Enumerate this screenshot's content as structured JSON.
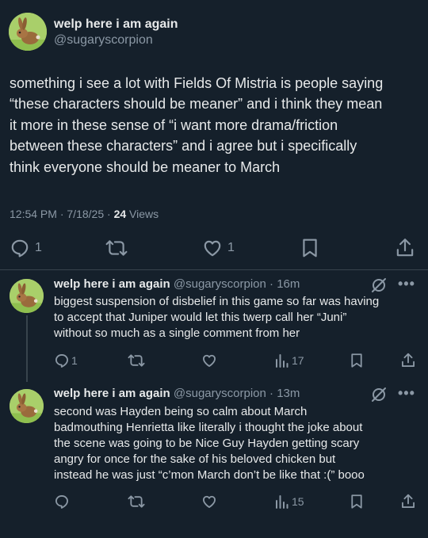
{
  "main_tweet": {
    "author_name": "welp here i am again",
    "author_handle": "@sugaryscorpion",
    "text_lines": [
      "something i see a lot with Fields Of Mistria is people saying",
      "“these characters should be meaner” and i think they mean",
      "it more in these sense of “i want more drama/friction",
      "between these characters” and i agree but i specifically",
      "think everyone should be meaner to March"
    ],
    "time": "12:54 PM",
    "date": "7/18/25",
    "separator": "·",
    "views_count": "24",
    "views_label": "Views",
    "replies": "1",
    "likes": "1",
    "icons": [
      "reply-icon",
      "retweet-icon",
      "like-icon",
      "bookmark-icon",
      "share-icon"
    ]
  },
  "replies": [
    {
      "author_name": "welp here i am again",
      "author_handle": "@sugaryscorpion",
      "separator": "·",
      "age": "16m",
      "text_lines": [
        "biggest suspension of disbelief in this game so far was having",
        "to accept that Juniper would let this twerp call her “Juni”",
        "without so much as a single comment from her"
      ],
      "reply_count": "1",
      "views": "17"
    },
    {
      "author_name": "welp here i am again",
      "author_handle": "@sugaryscorpion",
      "separator": "·",
      "age": "13m",
      "text_lines": [
        "second was Hayden being so calm about March",
        "badmouthing Henrietta like literally i thought the joke about",
        "the scene was going to be Nice Guy Hayden getting scary",
        "angry for once for the sake of his beloved chicken but",
        "instead he was just “c’mon March don’t be like that :(” booo"
      ],
      "views": "15"
    }
  ],
  "colors": {
    "background": "#15202b",
    "text": "#e7e9ea",
    "secondary": "#8b98a5",
    "divider": "#38444d",
    "avatar_bg": "#a9cf6a"
  }
}
